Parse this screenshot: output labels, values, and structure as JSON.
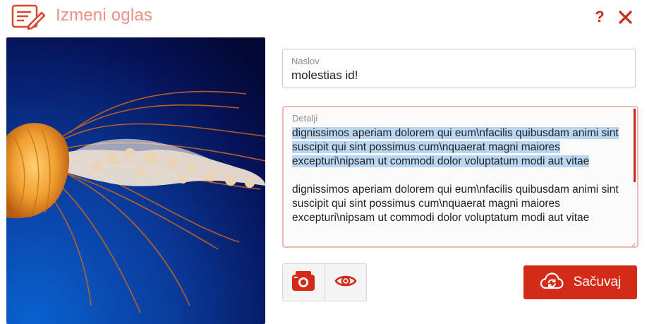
{
  "header": {
    "title": "Izmeni oglas",
    "help_label": "?",
    "icon": "edit-note-icon"
  },
  "image": {
    "alt": "jellyfish-photo"
  },
  "form": {
    "title_field": {
      "label": "Naslov",
      "value": "molestias id!"
    },
    "details_field": {
      "label": "Detalji",
      "paragraphs": [
        "dignissimos aperiam dolorem qui eum\\nfacilis quibusdam animi sint suscipit qui sint possimus cum\\nquaerat magni maiores excepturi\\nipsam ut commodi dolor voluptatum modi aut vitae",
        "dignissimos aperiam dolorem qui eum\\nfacilis quibusdam animi sint suscipit qui sint possimus cum\\nquaerat magni maiores excepturi\\nipsam ut commodi dolor voluptatum modi aut vitae"
      ]
    }
  },
  "toolbar": {
    "camera_icon": "camera-icon",
    "preview_icon": "eye-icon",
    "save_label": "Sačuvaj",
    "save_icon": "cloud-sync-icon"
  },
  "colors": {
    "accent": "#d42a18",
    "title": "#ec8f84",
    "selection": "#b9d7f2"
  }
}
